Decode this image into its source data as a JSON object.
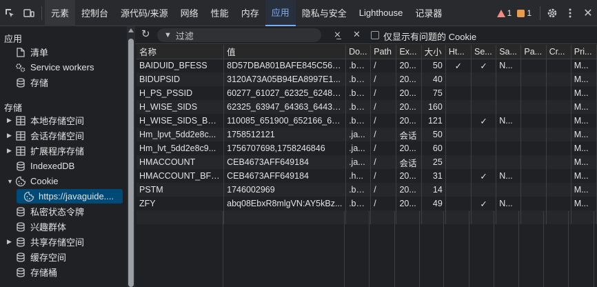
{
  "tabs": [
    "元素",
    "控制台",
    "源代码/来源",
    "网络",
    "性能",
    "内存",
    "应用",
    "隐私与安全",
    "Lighthouse",
    "记录器"
  ],
  "active_tab_index": 6,
  "status": {
    "errors": "1",
    "issues": "1"
  },
  "sidebar": {
    "app_title": "应用",
    "app_items": [
      {
        "label": "清单",
        "icon": "file-icon"
      },
      {
        "label": "Service workers",
        "icon": "gears-icon"
      },
      {
        "label": "存储",
        "icon": "database-icon"
      }
    ],
    "storage_title": "存储",
    "storage_items": [
      {
        "label": "本地存储空间",
        "icon": "table-icon",
        "expandable": true
      },
      {
        "label": "会话存储空间",
        "icon": "table-icon",
        "expandable": true
      },
      {
        "label": "扩展程序存储",
        "icon": "table-icon",
        "expandable": true
      },
      {
        "label": "IndexedDB",
        "icon": "database-icon",
        "expandable": false
      },
      {
        "label": "Cookie",
        "icon": "cookie-icon",
        "expandable": true,
        "expanded": true
      },
      {
        "label": "https://javaguide....",
        "icon": "cookie-icon",
        "selected": true,
        "child": true
      },
      {
        "label": "私密状态令牌",
        "icon": "database-icon",
        "expandable": false
      },
      {
        "label": "兴趣群体",
        "icon": "database-icon",
        "expandable": false
      },
      {
        "label": "共享存储空间",
        "icon": "database-icon",
        "expandable": true
      },
      {
        "label": "缓存空间",
        "icon": "database-icon",
        "expandable": false
      },
      {
        "label": "存储桶",
        "icon": "database-icon",
        "expandable": false
      }
    ]
  },
  "toolbar": {
    "filter_placeholder": "过滤",
    "only_issues_label": "仅显示有问题的 Cookie"
  },
  "table": {
    "columns": [
      "名称",
      "值",
      "Do...",
      "Path",
      "Ex...",
      "大小",
      "Ht...",
      "Se...",
      "Sa...",
      "Pa...",
      "Cr...",
      "Pri..."
    ],
    "rows": [
      [
        "BAIDUID_BFESS",
        "8D57DBA801BAFE845C565...",
        ".ba...",
        "/",
        "20...",
        "50",
        "✓",
        "✓",
        "N...",
        "",
        "",
        "M..."
      ],
      [
        "BIDUPSID",
        "3120A73A05B94EA8997E1...",
        ".ba...",
        "/",
        "20...",
        "40",
        "",
        "",
        "",
        "",
        "",
        "M..."
      ],
      [
        "H_PS_PSSID",
        "60277_61027_62325_62485...",
        ".ba...",
        "/",
        "20...",
        "75",
        "",
        "",
        "",
        "",
        "",
        "M..."
      ],
      [
        "H_WISE_SIDS",
        "62325_63947_64363_64438...",
        ".ba...",
        "/",
        "20...",
        "160",
        "",
        "",
        "",
        "",
        "",
        "M..."
      ],
      [
        "H_WISE_SIDS_BFESS",
        "110085_651900_652166_65...",
        ".ba...",
        "/",
        "20...",
        "121",
        "",
        "✓",
        "N...",
        "",
        "",
        "M..."
      ],
      [
        "Hm_lpvt_5dd2e8c...",
        "1758512121",
        ".ja...",
        "/",
        "会话",
        "50",
        "",
        "",
        "",
        "",
        "",
        "M..."
      ],
      [
        "Hm_lvt_5dd2e8c9...",
        "1756707698,1758246846",
        ".ja...",
        "/",
        "20...",
        "60",
        "",
        "",
        "",
        "",
        "",
        "M..."
      ],
      [
        "HMACCOUNT",
        "CEB4673AFF649184",
        ".ja...",
        "/",
        "会话",
        "25",
        "",
        "",
        "",
        "",
        "",
        "M..."
      ],
      [
        "HMACCOUNT_BFE...",
        "CEB4673AFF649184",
        ".h...",
        "/",
        "20...",
        "31",
        "",
        "✓",
        "N...",
        "",
        "",
        "M..."
      ],
      [
        "PSTM",
        "1746002969",
        ".ba...",
        "/",
        "20...",
        "14",
        "",
        "",
        "",
        "",
        "",
        "M..."
      ],
      [
        "ZFY",
        "abq08EbxR8mlgVN:AY5kBz...",
        ".ba...",
        "/",
        "20...",
        "49",
        "",
        "✓",
        "N...",
        "",
        "",
        "M..."
      ]
    ]
  },
  "colors": {
    "accent": "#7cacf8",
    "selected_bg": "#004a77",
    "error": "#f28b82",
    "issue": "#e89d4e"
  }
}
